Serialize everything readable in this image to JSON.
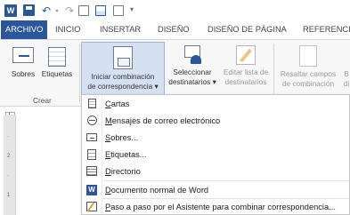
{
  "colors": {
    "accent": "#2b579a",
    "ribbon_bg": "#f7f7f7",
    "hover": "#d5e1f2",
    "menu_selected": "#e1e1e1"
  },
  "quick_access": {
    "icons": [
      "word-logo-icon",
      "save-icon",
      "undo-icon",
      "redo-icon",
      "new-document-icon",
      "open-icon",
      "print-preview-icon",
      "customize-icon"
    ],
    "word_logo": "W",
    "undo_glyph": "↶",
    "redo_glyph": "↷",
    "more_glyph": "▾",
    "dd_glyph": "▾"
  },
  "tabs": [
    {
      "label": "ARCHIVO",
      "active": true
    },
    {
      "label": "INICIO"
    },
    {
      "label": "INSERTAR"
    },
    {
      "label": "DISEÑO"
    },
    {
      "label": "DISEÑO DE PÁGINA"
    },
    {
      "label": "REFERENCIAS"
    }
  ],
  "ribbon": {
    "group_label": "Crear",
    "buttons": {
      "sobres": "Sobres",
      "etiquetas": "Etiquetas",
      "iniciar_l1": "Iniciar combinación",
      "iniciar_l2": "de correspondencia ▾",
      "seleccionar_l1": "Seleccionar",
      "seleccionar_l2": "destinatarios ▾",
      "editar_l1": "Editar lista de",
      "editar_l2": "destinatarios",
      "resaltar_l1": "Resaltar campos",
      "resaltar_l2": "de combinación",
      "cut_l1": "B",
      "cut_l2": "di"
    }
  },
  "ruler": {
    "corner": "L",
    "marks": [
      "·",
      "2",
      "·",
      "1"
    ]
  },
  "menu": {
    "items": [
      {
        "pre": "",
        "u": "C",
        "rest": "artas",
        "icon": "letters-icon"
      },
      {
        "pre": "",
        "u": "M",
        "rest": "ensajes de correo electrónico",
        "icon": "email-icon"
      },
      {
        "pre": "",
        "u": "S",
        "rest": "obres...",
        "icon": "envelope-icon"
      },
      {
        "pre": "",
        "u": "E",
        "rest": "tiquetas...",
        "icon": "labels-icon"
      },
      {
        "pre": "",
        "u": "D",
        "rest": "irectorio",
        "icon": "directory-icon"
      },
      {
        "pre": "",
        "u": "D",
        "rest": "ocumento normal de Word",
        "icon": "word-document-icon",
        "selected": true
      },
      {
        "pre": "",
        "u": "P",
        "rest": "aso a paso por el Asistente para combinar correspondencia...",
        "icon": "wizard-icon"
      }
    ]
  }
}
